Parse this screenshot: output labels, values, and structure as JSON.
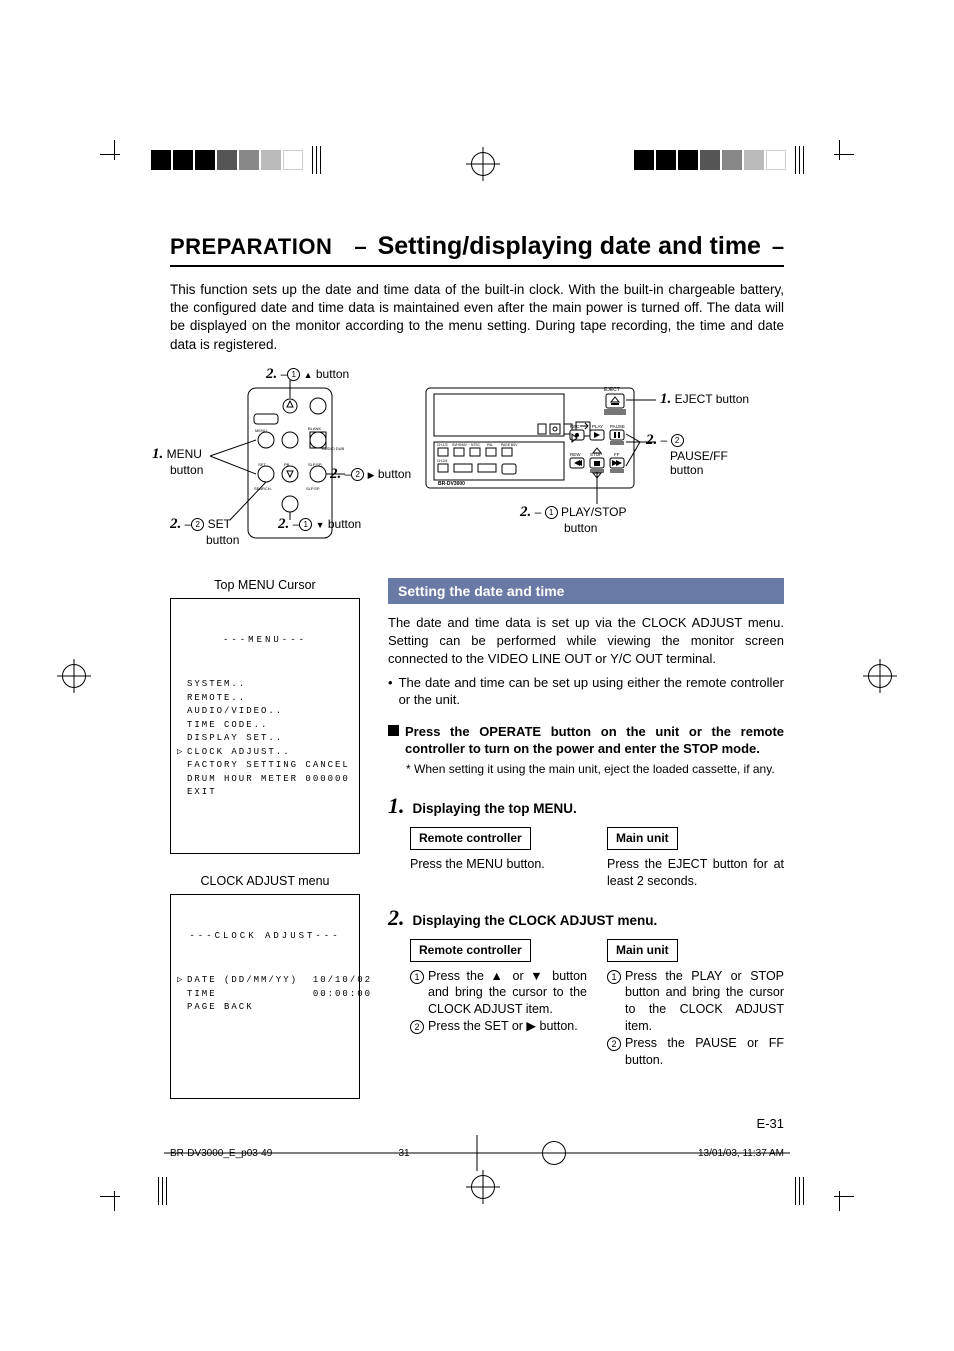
{
  "header": {
    "section": "PREPARATION",
    "title": "Setting/displaying date and time"
  },
  "intro": "This function sets up the date and time data of the built-in clock. With the built-in chargeable battery, the configured date and time data is maintained even after the main power is turned off. The data will be displayed on the monitor according to the menu setting. During tape recording, the time and date data is registered.",
  "diagram_remote": {
    "c1": {
      "num": "1.",
      "label": "MENU",
      "sub": "button"
    },
    "c2a": {
      "num": "2.",
      "circ": "1",
      "label": " button"
    },
    "c2b": {
      "num": "2.",
      "circ": "2",
      "label": " button"
    },
    "c2c": {
      "num": "2.",
      "circ": "1",
      "label": " button"
    },
    "c2d": {
      "num": "2.",
      "circ": "2",
      "label": "SET",
      "sub": "button"
    }
  },
  "diagram_unit": {
    "eject_small": "EJECT",
    "rec": "REC",
    "play": "PLAY",
    "pause": "PAUSE",
    "rew": "REW",
    "stop": "STOP",
    "ff": "FF",
    "model": "BR-DV3000",
    "c1": {
      "num": "1.",
      "label": "EJECT button"
    },
    "c2a": {
      "num": "2.",
      "circ": "2",
      "label": "PAUSE/FF",
      "sub": "button"
    },
    "c2b": {
      "num": "2.",
      "circ": "1",
      "label": "PLAY/STOP",
      "sub": "button"
    }
  },
  "osd1": {
    "caption": "Top MENU Cursor",
    "header": "---MENU---",
    "lines": [
      "SYSTEM..",
      "REMOTE..",
      "AUDIO/VIDEO..",
      "TIME CODE..",
      "DISPLAY SET..",
      "CLOCK ADJUST..",
      "FACTORY SETTING CANCEL",
      "DRUM HOUR METER 000000",
      "EXIT"
    ],
    "cursor_index": 5
  },
  "osd2": {
    "caption": "CLOCK ADJUST menu",
    "header": "---CLOCK ADJUST---",
    "rows": [
      {
        "l": "DATE (DD/MM/YY)",
        "r": "10/10/02"
      },
      {
        "l": "TIME",
        "r": "00:00:00"
      },
      {
        "l": "PAGE BACK",
        "r": ""
      }
    ],
    "cursor_index": 0
  },
  "section_bar": "Setting the date and time",
  "body": {
    "p1": "The date and time data is set up via the CLOCK ADJUST menu. Setting can be performed while viewing the monitor screen connected to the VIDEO LINE OUT or Y/C OUT terminal.",
    "bullet1": "The date and time can be set up using either the remote controller or the unit.",
    "black": "Press the OPERATE button on the unit or the remote controller to turn on the power and enter the STOP mode.",
    "asterisk": "When setting it using the main unit, eject the loaded cassette, if any."
  },
  "steps": [
    {
      "num": "1.",
      "title": "Displaying the top MENU.",
      "remote_label": "Remote controller",
      "main_label": "Main unit",
      "remote_body": "Press the MENU button.",
      "main_body": "Press the EJECT button for at least 2 seconds."
    },
    {
      "num": "2.",
      "title": "Displaying the CLOCK ADJUST menu.",
      "remote_label": "Remote controller",
      "main_label": "Main unit",
      "remote_lines": [
        {
          "c": "1",
          "t": "Press the ▲ or ▼ button and bring the cursor to the CLOCK ADJUST item."
        },
        {
          "c": "2",
          "t": "Press the SET or ▶ button."
        }
      ],
      "main_lines": [
        {
          "c": "1",
          "t": "Press the PLAY or STOP button and bring the cursor to the CLOCK ADJUST item."
        },
        {
          "c": "2",
          "t": "Press the PAUSE or FF button."
        }
      ]
    }
  ],
  "page_num": "E-31",
  "footer": {
    "file": "BR-DV3000_E_p03-49",
    "page": "31",
    "date": "13/01/03, 11:37 AM"
  }
}
